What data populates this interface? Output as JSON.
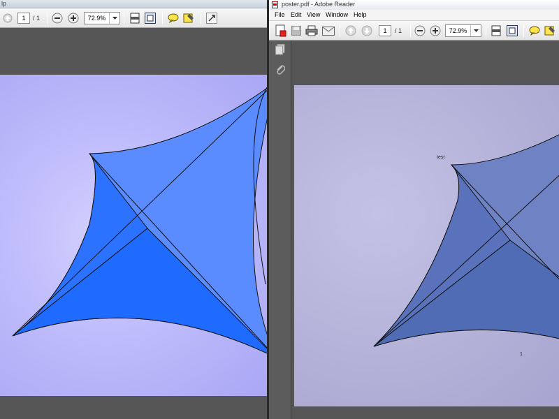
{
  "left_window": {
    "title": "lp",
    "toolbar": {
      "page_current": "1",
      "page_total": "/ 1",
      "zoom": "72.9%"
    }
  },
  "right_window": {
    "title": "poster.pdf - Adobe Reader",
    "menu": [
      "File",
      "Edit",
      "View",
      "Window",
      "Help"
    ],
    "toolbar": {
      "page_current": "1",
      "page_total": "/ 1",
      "zoom": "72.9%"
    },
    "page": {
      "label_test": "test",
      "label_number": "1"
    }
  },
  "colors": {
    "left_shape_dark": "#1f6aff",
    "left_shape_light": "#5a8bff",
    "right_shape_dark": "#4f6cb5",
    "right_shape_light": "#6f83c4"
  }
}
